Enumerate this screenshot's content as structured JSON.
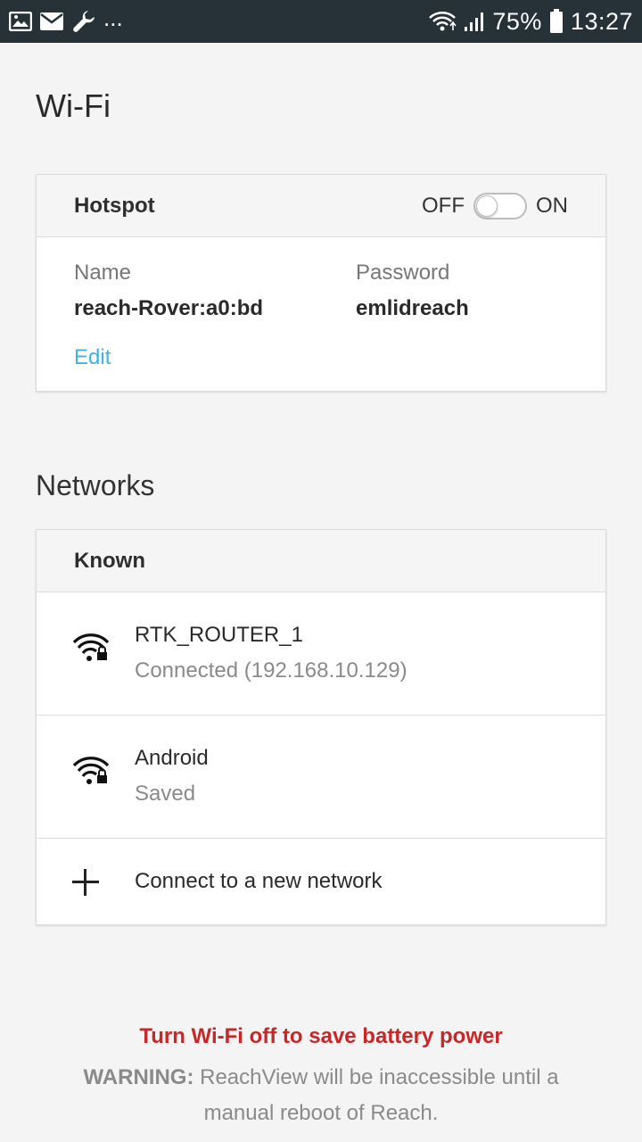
{
  "status_bar": {
    "left_icons": [
      "image-icon",
      "mail-icon",
      "wrench-icon"
    ],
    "more": "...",
    "battery": "75%",
    "time": "13:27",
    "right_icons": [
      "wifi-icon",
      "signal-icon",
      "battery-icon"
    ]
  },
  "page": {
    "title": "Wi-Fi"
  },
  "hotspot": {
    "header": "Hotspot",
    "toggle_off": "OFF",
    "toggle_on": "ON",
    "toggle_state": "off",
    "name_label": "Name",
    "name_value": "reach-Rover:a0:bd",
    "password_label": "Password",
    "password_value": "emlidreach",
    "edit_label": "Edit"
  },
  "networks": {
    "title": "Networks",
    "known_header": "Known",
    "items": [
      {
        "name": "RTK_ROUTER_1",
        "status": "Connected (192.168.10.129)",
        "icon": "wifi-lock-icon"
      },
      {
        "name": "Android",
        "status": "Saved",
        "icon": "wifi-lock-icon"
      }
    ],
    "new_network_label": "Connect to a new network"
  },
  "footer": {
    "warning_title": "Turn Wi-Fi off to save battery power",
    "warning_prefix": "WARNING:",
    "warning_text": "ReachView will be inaccessible until a manual reboot of Reach."
  },
  "colors": {
    "status_bar": "#263238",
    "link": "#3fb1e3",
    "warning": "#c62828",
    "background": "#f4f4f4"
  }
}
